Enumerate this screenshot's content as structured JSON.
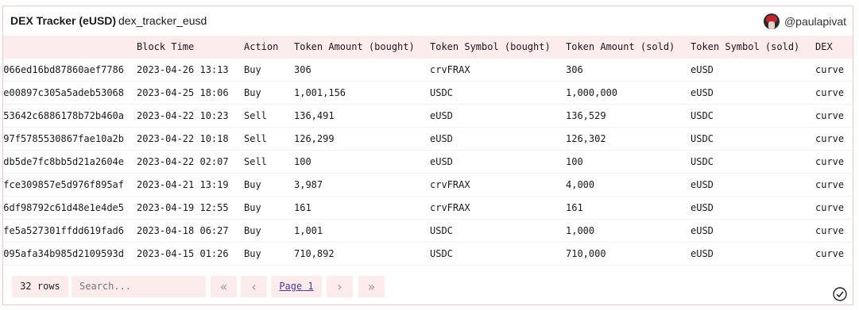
{
  "header": {
    "title": "DEX Tracker (eUSD)",
    "subtitle": "dex_tracker_eusd",
    "author": "@paulapivat"
  },
  "table": {
    "columns": [
      "",
      "Block Time",
      "Action",
      "Token Amount (bought)",
      "Token Symbol (bought)",
      "Token Amount (sold)",
      "Token Symbol (sold)",
      "DEX"
    ],
    "rows": [
      [
        "066ed16bd87860aef7786",
        "2023-04-26 13:13",
        "Buy",
        "306",
        "crvFRAX",
        "306",
        "eUSD",
        "curve"
      ],
      [
        "e00897c305a5adeb53068",
        "2023-04-25 18:06",
        "Buy",
        "1,001,156",
        "USDC",
        "1,000,000",
        "eUSD",
        "curve"
      ],
      [
        "53642c6886178b72b460a",
        "2023-04-22 10:23",
        "Sell",
        "136,491",
        "eUSD",
        "136,529",
        "USDC",
        "curve"
      ],
      [
        "97f5785530867fae10a2b",
        "2023-04-22 10:18",
        "Sell",
        "126,299",
        "eUSD",
        "126,302",
        "USDC",
        "curve"
      ],
      [
        "db5de7fc8bb5d21a2604e",
        "2023-04-22 02:07",
        "Sell",
        "100",
        "eUSD",
        "100",
        "USDC",
        "curve"
      ],
      [
        "fce309857e5d976f895af",
        "2023-04-21 13:19",
        "Buy",
        "3,987",
        "crvFRAX",
        "4,000",
        "eUSD",
        "curve"
      ],
      [
        "6df98792c61d48e1e4de5",
        "2023-04-19 12:55",
        "Buy",
        "161",
        "crvFRAX",
        "161",
        "eUSD",
        "curve"
      ],
      [
        "fe5a527301ffdd619fad6",
        "2023-04-18 06:27",
        "Buy",
        "1,001",
        "USDC",
        "1,000",
        "eUSD",
        "curve"
      ],
      [
        "095afa34b985d2109593d",
        "2023-04-15 01:26",
        "Buy",
        "710,892",
        "USDC",
        "710,000",
        "eUSD",
        "curve"
      ]
    ]
  },
  "footer": {
    "rows_count": "32 rows",
    "search_placeholder": "Search...",
    "page_label": "Page 1",
    "first_icon": "«",
    "prev_icon": "‹",
    "next_icon": "›",
    "last_icon": "»"
  },
  "colors": {
    "accent_bg": "#fdecec",
    "border": "#f3c9c4",
    "link": "#4a3aa8"
  }
}
